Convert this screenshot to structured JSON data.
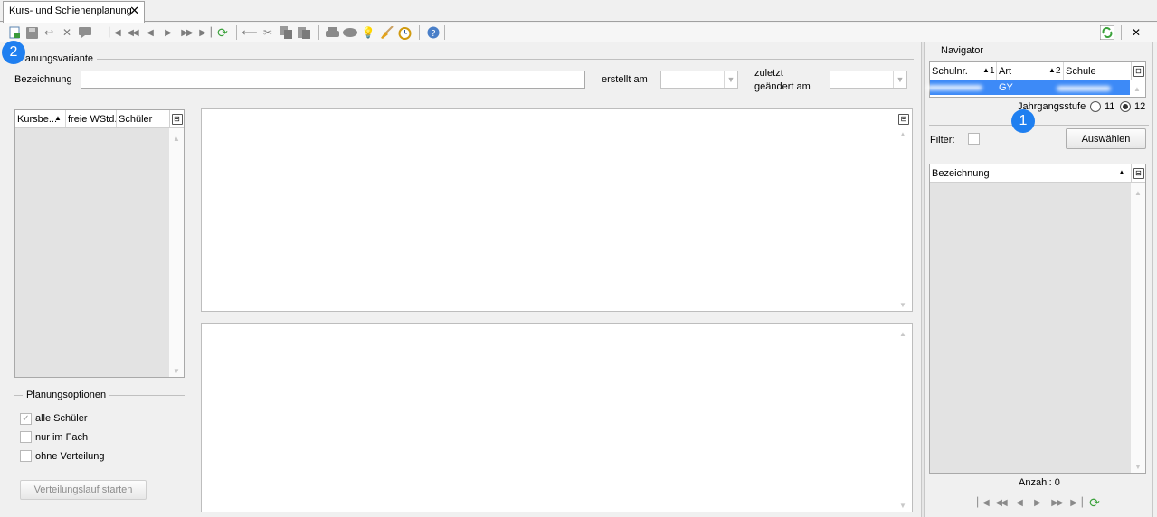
{
  "tabs": [
    {
      "label": "Kurs- und Schienenplanung",
      "close_glyph": "✕"
    }
  ],
  "toolbar": {
    "icons": [
      "new-icon",
      "save-icon",
      "undo-icon",
      "delete-icon",
      "comment-icon",
      "first-icon",
      "prev-page-icon",
      "prev-icon",
      "next-icon",
      "next-page-icon",
      "last-icon",
      "refresh-icon",
      "back-arrow-icon",
      "cut-icon",
      "copy-icon",
      "paste-icon",
      "print-icon",
      "preview-icon",
      "idea-icon",
      "brush-icon",
      "alarm-clock-icon",
      "help-icon"
    ],
    "right_close": "✕"
  },
  "planungsvariante": {
    "title": "Planungsvariante",
    "bezeichnung_label": "Bezeichnung",
    "bezeichnung_value": "",
    "erstellt_label": "erstellt am",
    "erstellt_value": "",
    "geaendert_label_1": "zuletzt",
    "geaendert_label_2": "geändert am",
    "geaendert_value": ""
  },
  "kurs_grid": {
    "columns": [
      "Kursbe...",
      "freie WStd.",
      "Schüler"
    ]
  },
  "planungsoptionen": {
    "title": "Planungsoptionen",
    "options": [
      {
        "label": "alle Schüler",
        "checked": true
      },
      {
        "label": "nur im Fach",
        "checked": false
      },
      {
        "label": "ohne Verteilung",
        "checked": false
      }
    ],
    "start_button": "Verteilungslauf starten"
  },
  "navigator": {
    "title": "Navigator",
    "columns": [
      "Schulnr.",
      "Art",
      "Schule"
    ],
    "sort_marks": [
      "1",
      "2"
    ],
    "selected_row": {
      "schulnr": "",
      "art": "GY",
      "schule": ""
    },
    "jahrgangsstufe_label": "Jahrgangsstufe",
    "jahrgang_options": [
      {
        "label": "11",
        "selected": false
      },
      {
        "label": "12",
        "selected": true
      }
    ],
    "filter_label": "Filter:",
    "filter_checked": false,
    "auswaehlen_button": "Auswählen",
    "list_column": "Bezeichnung",
    "count_label": "Anzahl: 0"
  },
  "badges": {
    "one": "1",
    "two": "2"
  },
  "colors": {
    "accent": "#1f7ff0",
    "selection": "#3d8af7"
  }
}
